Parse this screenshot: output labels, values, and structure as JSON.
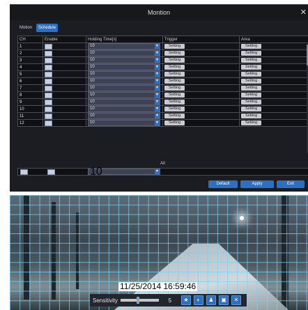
{
  "dialog": {
    "title": "Montion",
    "close_icon": "close-icon",
    "tabs": [
      "Motion",
      "Schedule"
    ],
    "active_tab": "Schedule",
    "columns": [
      "CH",
      "Enable",
      "Holding Time[s]",
      "Trigger",
      "Area"
    ],
    "rows": [
      {
        "ch": "1",
        "holding": "10",
        "trigger": "Setting",
        "area": "Setting"
      },
      {
        "ch": "2",
        "holding": "10",
        "trigger": "Setting",
        "area": "Setting"
      },
      {
        "ch": "3",
        "holding": "10",
        "trigger": "Setting",
        "area": "Setting"
      },
      {
        "ch": "4",
        "holding": "10",
        "trigger": "Setting",
        "area": "Setting"
      },
      {
        "ch": "5",
        "holding": "10",
        "trigger": "Setting",
        "area": "Setting"
      },
      {
        "ch": "6",
        "holding": "10",
        "trigger": "Setting",
        "area": "Setting"
      },
      {
        "ch": "7",
        "holding": "10",
        "trigger": "Setting",
        "area": "Setting"
      },
      {
        "ch": "8",
        "holding": "10",
        "trigger": "Setting",
        "area": "Setting"
      },
      {
        "ch": "9",
        "holding": "10",
        "trigger": "Setting",
        "area": "Setting"
      },
      {
        "ch": "10",
        "holding": "10",
        "trigger": "Setting",
        "area": "Setting"
      },
      {
        "ch": "11",
        "holding": "10",
        "trigger": "Setting",
        "area": "Setting"
      },
      {
        "ch": "12",
        "holding": "10",
        "trigger": "Setting",
        "area": "Setting"
      }
    ],
    "all_label": "All",
    "all_holding": "10",
    "buttons": {
      "default": "Default",
      "apply": "Apply",
      "exit": "Exit"
    },
    "colors": {
      "accent": "#2d6fc0",
      "background": "#1b1d22"
    }
  },
  "camera": {
    "timestamp": "11/25/2014  16:59:46",
    "sensitivity_label": "Sensitivity",
    "sensitivity_value": "5",
    "sensitivity_fraction": 0.45,
    "tools": [
      "select-all-icon",
      "clear-icon",
      "person-icon",
      "save-icon",
      "close-icon"
    ],
    "grid_color": "#78d2f0"
  }
}
